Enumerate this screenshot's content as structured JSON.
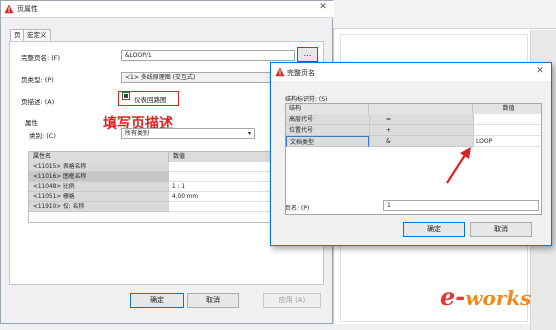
{
  "main_dialog": {
    "title": "页属性",
    "tabs": [
      "页",
      "宏定义"
    ],
    "full_name_label": "完整页名: (F)",
    "full_name_value": "&LOOP/1",
    "page_type_label": "页类型: (P)",
    "page_type_value": "<1> 多线原理图 (交互式)",
    "page_desc_label": "页描述: (A)",
    "page_desc_value": "仪表回路图",
    "props_section_label": "属性",
    "category_label": "类别: (C)",
    "category_value": "所有类别",
    "prop_headers": [
      "属性名",
      "数值"
    ],
    "prop_rows": [
      {
        "name": "<11015> 表格名称",
        "value": ""
      },
      {
        "name": "<11016> 图框名称",
        "value": ""
      },
      {
        "name": "<11048> 比例",
        "value": "1 : 1"
      },
      {
        "name": "<11051> 栅格",
        "value": "4.00 mm"
      },
      {
        "name": "<11910> 仅: 名称",
        "value": ""
      }
    ],
    "buttons": {
      "ok": "确定",
      "cancel": "取消",
      "apply": "应用 (A)"
    }
  },
  "annotation": {
    "text": "填写页描述",
    "color": "#e02020"
  },
  "dialog2": {
    "title": "完整页名",
    "struct_label": "结构标识符: (S)",
    "headers": [
      "结构",
      "",
      "数值"
    ],
    "rows": [
      {
        "struct": "高层代号",
        "sep": "=",
        "value": ""
      },
      {
        "struct": "位置代号",
        "sep": "+",
        "value": ""
      },
      {
        "struct": "文档类型",
        "sep": "&",
        "value": "LOOP"
      }
    ],
    "page_name_label": "页名: (P)",
    "page_name_value": "1",
    "buttons": {
      "ok": "确定",
      "cancel": "取消"
    }
  },
  "logo": {
    "text": "works",
    "prefix": "e-"
  },
  "icons": [
    "warning-icon",
    "close-icon",
    "dropdown-icon",
    "ellipsis-icon",
    "checkbox-icon",
    "arrow-annotation"
  ]
}
